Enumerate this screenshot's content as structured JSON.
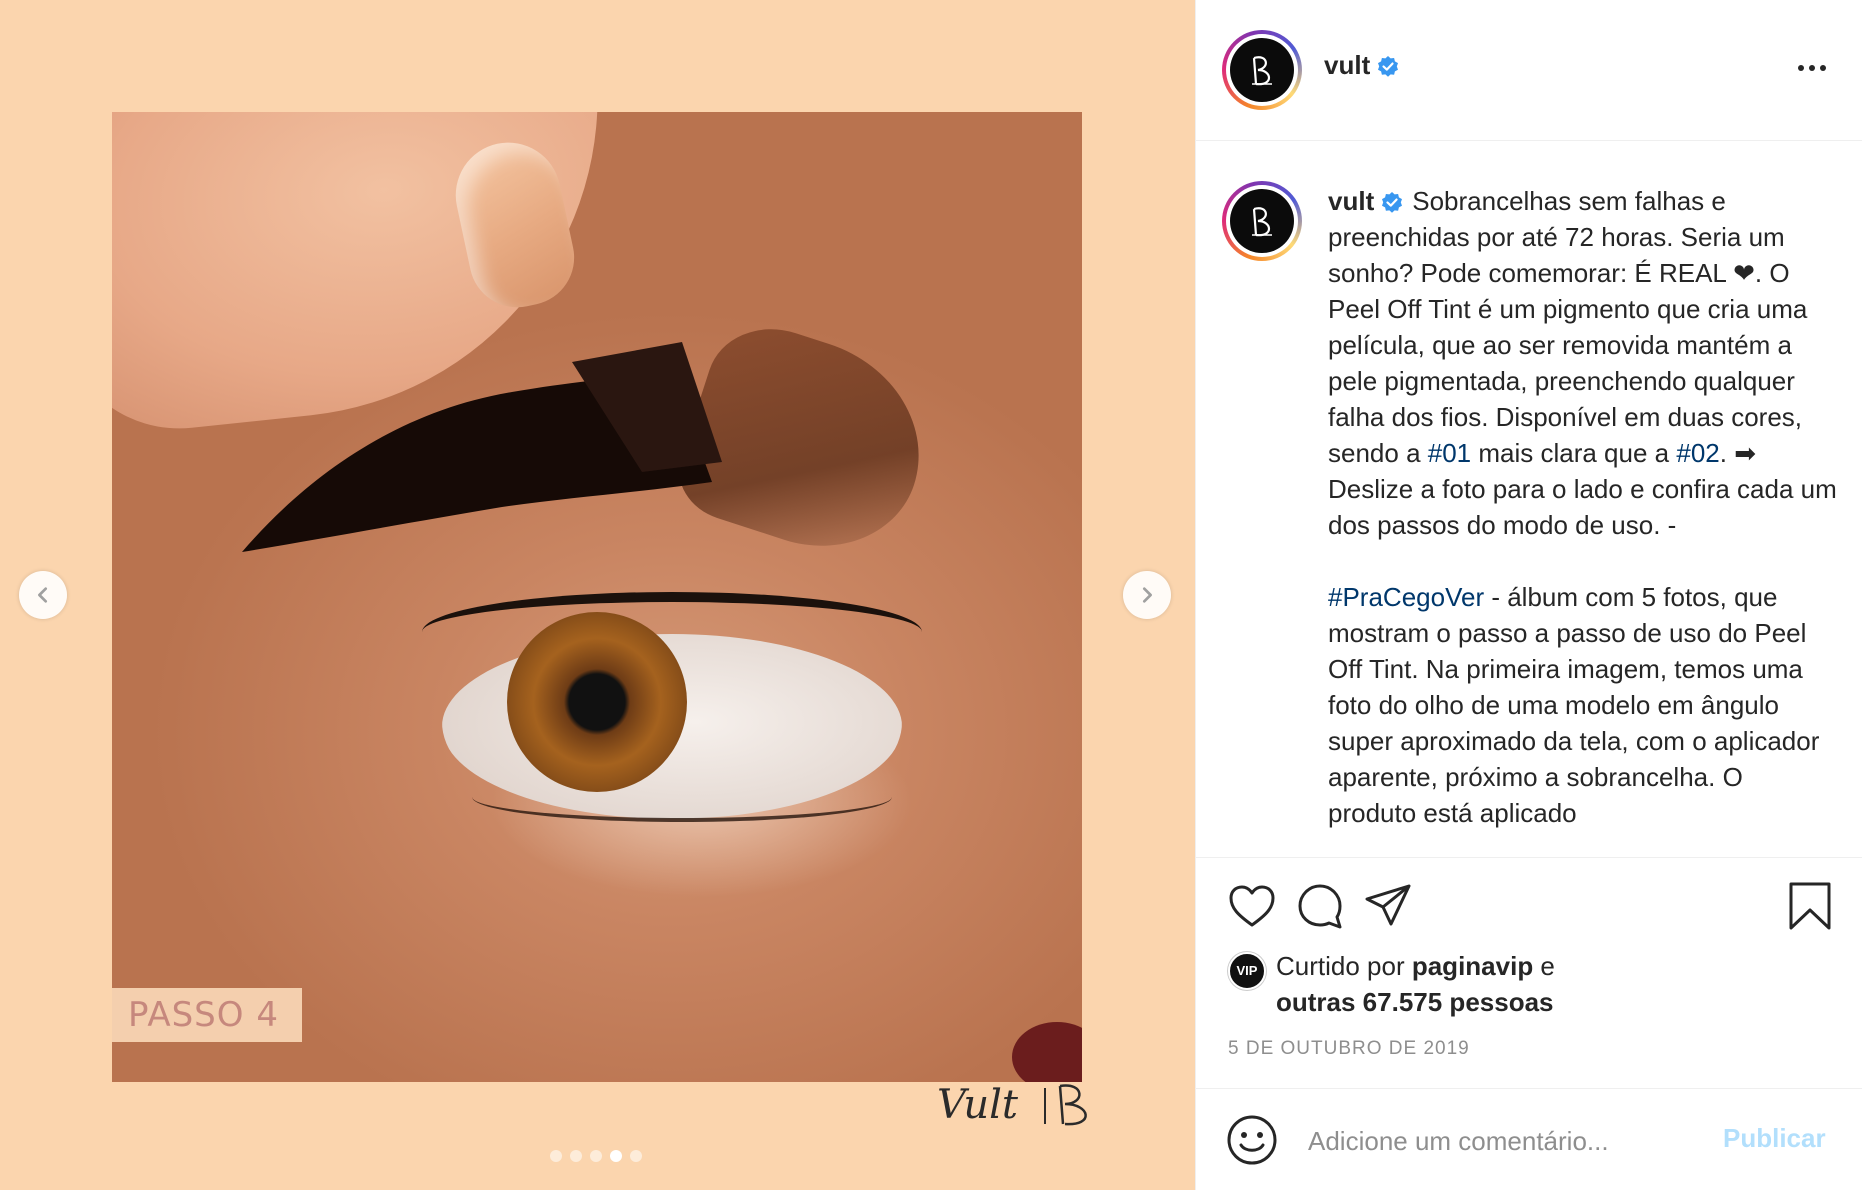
{
  "media": {
    "step_label": "PASSO 4",
    "brand_watermark": "Vult",
    "carousel": {
      "total": 5,
      "active": 4
    }
  },
  "post_header": {
    "username": "vult",
    "verified": true
  },
  "caption": {
    "username": "vult",
    "p1_a": "Sobrancelhas sem falhas e preenchidas por até 72 horas. Seria um sonho? Pode comemorar: É REAL ❤. O Peel Off Tint é um pigmento que cria uma película, que ao ser removida mantém a pele pigmentada, preenchendo qualquer falha dos fios. Disponível em duas cores, sendo a ",
    "tag1": "#01",
    "p1_b": " mais clara que a ",
    "tag2": "#02",
    "p1_c": ". ➡ Deslize a foto para o lado e confira cada um dos passos do modo de uso. -",
    "tag3": "#PraCegoVer",
    "p2": " - álbum com 5 fotos, que mostram o passo a passo de uso do Peel Off Tint. Na primeira imagem, temos uma foto do olho de uma modelo em ângulo super aproximado da tela, com o aplicador aparente, próximo a sobrancelha. O produto está aplicado"
  },
  "likes": {
    "badge": "VIP",
    "prefix": "Curtido por ",
    "liker": "paginavip",
    "connector": " e",
    "others": "outras 67.575 pessoas"
  },
  "date": "5 DE OUTUBRO DE 2019",
  "comment": {
    "placeholder": "Adicione um comentário...",
    "publish_label": "Publicar"
  },
  "colors": {
    "media_bg": "#fbd5ae",
    "link": "#00376b",
    "verified": "#3897f0",
    "publish_disabled": "#b2dffc",
    "muted": "#8e8e8e"
  }
}
